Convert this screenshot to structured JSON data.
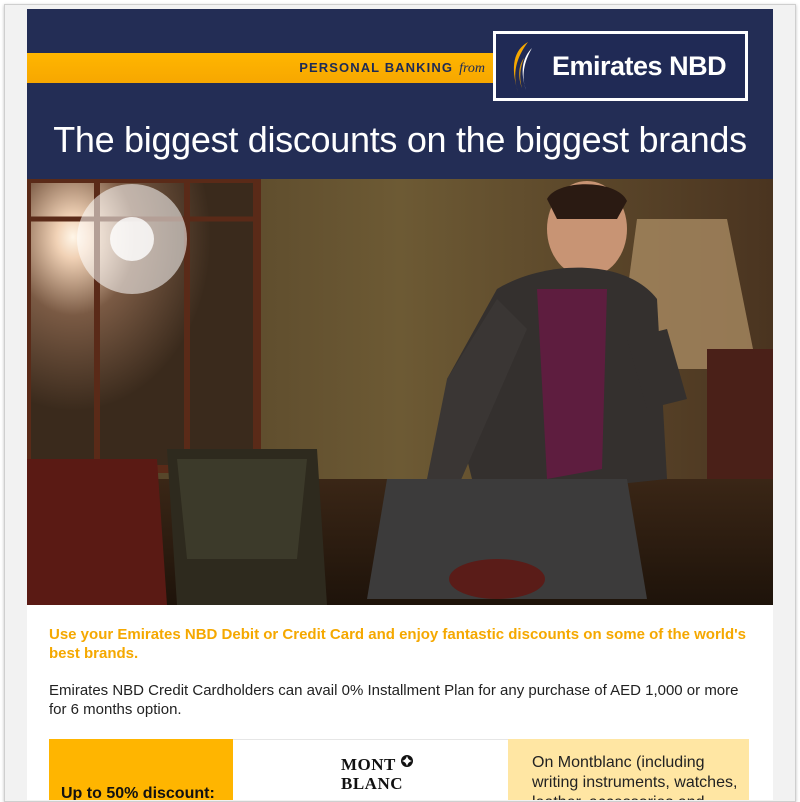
{
  "header": {
    "tagline": "PERSONAL BANKING",
    "tagline_suffix": "from",
    "brand": "Emirates NBD",
    "headline": "The biggest discounts on the biggest brands"
  },
  "hero": {
    "icon": "promo-photo-man-in-suit"
  },
  "body": {
    "intro": "Use your Emirates NBD Debit or Credit Card and enjoy fantastic discounts on some of the world's best brands.",
    "detail": "Emirates NBD Credit Cardholders can avail 0% Installment Plan for any purchase of AED 1,000 or more for 6 months option."
  },
  "offers": [
    {
      "discount": "Up to 50% discount:",
      "brand_line1": "MONT",
      "brand_line2": "BLANC",
      "description": "On Montblanc (including writing instruments, watches, leather, accessories and"
    }
  ],
  "colors": {
    "navy": "#232d55",
    "orange": "#ffb500",
    "intro_orange": "#f5a800",
    "offer_cream": "#ffe6a3"
  }
}
